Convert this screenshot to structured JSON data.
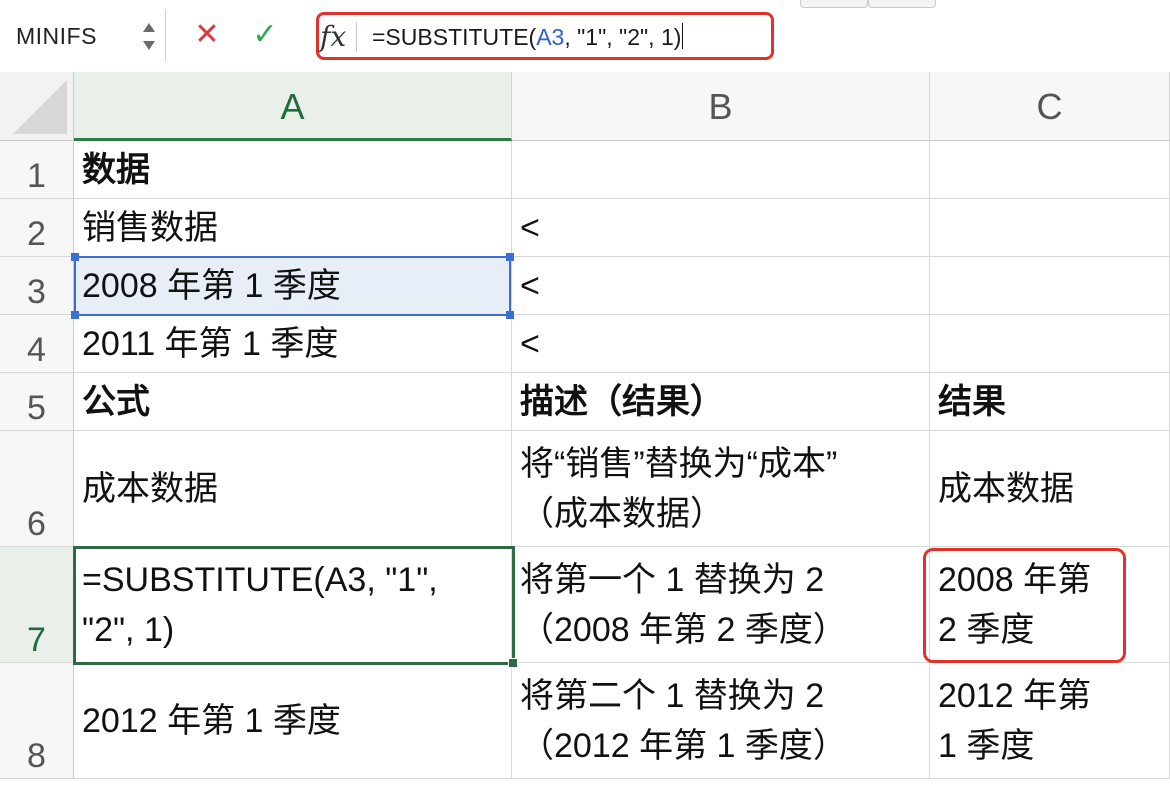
{
  "formula_bar": {
    "name_box": "MINIFS",
    "fx_label": "fx",
    "formula_prefix": "=SUBSTITUTE(",
    "formula_ref": "A3",
    "formula_suffix": ", \"1\", \"2\", 1)"
  },
  "columns": [
    "A",
    "B",
    "C"
  ],
  "rows": [
    "1",
    "2",
    "3",
    "4",
    "5",
    "6",
    "7",
    "8"
  ],
  "cells": {
    "A1": "数据",
    "A2": "销售数据",
    "A3": "2008 年第 1 季度",
    "A4": "2011 年第 1 季度",
    "A5": "公式",
    "A6": "成本数据",
    "A7": "=SUBSTITUTE(A3, \"1\",\n\"2\", 1)",
    "A8": "2012 年第 1 季度",
    "B1": "",
    "B2": "<",
    "B3": "<",
    "B4": "<",
    "B5": "描述（结果）",
    "B6": "将“销售”替换为“成本”\n（成本数据）",
    "B7": "将第一个 1 替换为 2\n（2008 年第 2 季度）",
    "B8": "将第二个 1 替换为 2\n（2012 年第 1 季度）",
    "C1": "",
    "C2": "",
    "C3": "",
    "C4": "",
    "C5": "结果",
    "C6": "成本数据",
    "C7": "2008 年第\n2 季度",
    "C8": "2012 年第\n1 季度"
  },
  "selection": {
    "range": "A3",
    "active_cell": "A7"
  },
  "colors": {
    "highlight_red": "#e0332b",
    "selection_blue": "#3b6fd4",
    "active_green": "#2e6b44"
  }
}
